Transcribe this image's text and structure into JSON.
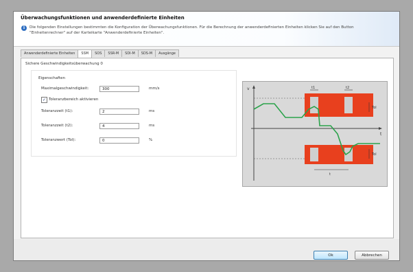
{
  "header": {
    "title": "Überwachungsfunktionen und anwenderdefinierte Einheiten",
    "description": "Die folgenden Einstellungen bestimmten die Konfiguration der Überwachungsfunktionen. Für die Berechnung der anwenderdefinierten Einheiten klicken Sie auf den Button \"Einheitenrechner\" auf der Karteikarte \"Anwenderdefinierte Einheiten\"."
  },
  "tabs": [
    {
      "label": "Anwenderdefinierte Einheiten",
      "active": false
    },
    {
      "label": "SSM",
      "active": true
    },
    {
      "label": "SOS",
      "active": false
    },
    {
      "label": "SSR-M",
      "active": false
    },
    {
      "label": "SDI-M",
      "active": false
    },
    {
      "label": "SDS-M",
      "active": false
    },
    {
      "label": "Ausgänge",
      "active": false
    }
  ],
  "section_title": "Sichere Geschwindigkeitsüberwachung 0",
  "properties": {
    "title": "Eigenschaften",
    "max_speed": {
      "label": "Maximalgeschwindigkeit:",
      "value": "300",
      "unit": "mm/s"
    },
    "tolerance_checkbox": {
      "label": "Toleranzbereich aktivieren",
      "checked": true
    },
    "tolerance_time_1": {
      "label": "Toleranzzeit (t1):",
      "value": "2",
      "unit": "ms"
    },
    "tolerance_time_2": {
      "label": "Toleranzzeit (t2):",
      "value": "4",
      "unit": "ms"
    },
    "tolerance_value": {
      "label": "Toleranzwert (Tol):",
      "value": "0",
      "unit": "%"
    }
  },
  "diagram": {
    "t1_label": "t1",
    "t2_label": "t2",
    "tol_label": "Tol",
    "v_label": "v",
    "t_label": "t",
    "colors": {
      "band": "#e8401e",
      "curve": "#2aa24a",
      "background": "#d9d9d9"
    }
  },
  "footer": {
    "ok_label": "Ok",
    "cancel_label": "Abbrechen"
  }
}
